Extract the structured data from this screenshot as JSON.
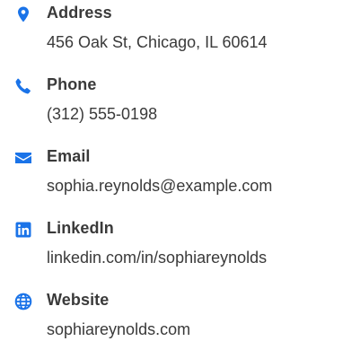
{
  "contact": {
    "items": [
      {
        "icon": "map-marker-icon",
        "label": "Address",
        "value": "456 Oak St, Chicago, IL 60614"
      },
      {
        "icon": "phone-icon",
        "label": "Phone",
        "value": "(312) 555-0198"
      },
      {
        "icon": "envelope-icon",
        "label": "Email",
        "value": "sophia.reynolds@example.com"
      },
      {
        "icon": "linkedin-icon",
        "label": "LinkedIn",
        "value": "linkedin.com/in/sophiareynolds"
      },
      {
        "icon": "globe-icon",
        "label": "Website",
        "value": "sophiareynolds.com"
      }
    ]
  },
  "colors": {
    "accent": "#1a73e8",
    "text": "#3a3a3a",
    "background": "#ffffff"
  }
}
